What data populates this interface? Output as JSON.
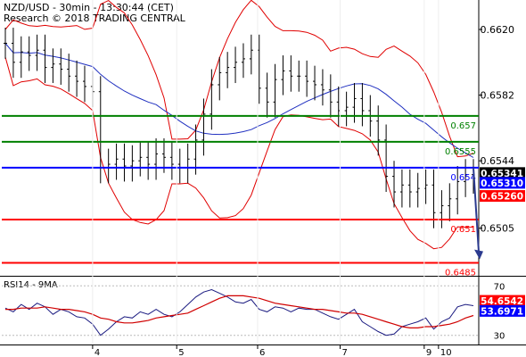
{
  "header": {
    "title": "NZD/USD - 30min - 13:30:44 (CET)",
    "copyright": "Research © 2018 TRADING CENTRAL"
  },
  "rsi_label": "RSI14 - 9MA",
  "chart_data": {
    "type": "candlestick",
    "instrument": "NZD/USD",
    "timeframe": "30min",
    "price_axis": {
      "ylim": [
        0.6478,
        0.6636
      ],
      "ticks": [
        {
          "label": "0.6620",
          "value": 0.662
        },
        {
          "label": "0.6582",
          "value": 0.6582
        },
        {
          "label": "0.6544",
          "value": 0.6544
        },
        {
          "label": "0.6505",
          "value": 0.6505
        }
      ]
    },
    "x_axis": {
      "ticks": [
        {
          "label": "4",
          "bar": 11
        },
        {
          "label": "5",
          "bar": 21.6
        },
        {
          "label": "6",
          "bar": 31.8
        },
        {
          "label": "7",
          "bar": 42.2
        },
        {
          "label": "9",
          "bar": 52.8
        },
        {
          "label": "10",
          "bar": 54.6
        }
      ],
      "n_bars": 60
    },
    "levels": [
      {
        "label": "0.657",
        "value": 0.657,
        "color": "#008000"
      },
      {
        "label": "0.6555",
        "value": 0.6555,
        "color": "#008000"
      },
      {
        "label": "0.654",
        "value": 0.654,
        "color": "#0000ff"
      },
      {
        "label": "0.651",
        "value": 0.651,
        "color": "#ff0000"
      },
      {
        "label": "0.6485",
        "value": 0.6485,
        "color": "#ff0000"
      }
    ],
    "price_badges": [
      {
        "label": "0.65341",
        "value": 0.65341,
        "bg": "#000000"
      },
      {
        "label": "0.65310",
        "value": 0.6531,
        "bg": "#0000ff"
      },
      {
        "label": "0.65260",
        "value": 0.6526,
        "bg": "#ff0000"
      }
    ],
    "forecast_arrow": {
      "from": 0.654,
      "to": 0.6487,
      "color": "#2b3a8f"
    },
    "close": [
      0.6612,
      0.6601,
      0.6607,
      0.6605,
      0.6608,
      0.6598,
      0.66,
      0.6597,
      0.6593,
      0.659,
      0.6587,
      0.6584,
      0.654,
      0.6542,
      0.6545,
      0.6541,
      0.6544,
      0.6546,
      0.6542,
      0.6548,
      0.6546,
      0.6542,
      0.654,
      0.6545,
      0.6556,
      0.6571,
      0.6588,
      0.6595,
      0.6598,
      0.6601,
      0.6603,
      0.6608,
      0.6586,
      0.6578,
      0.6591,
      0.6596,
      0.6593,
      0.6593,
      0.659,
      0.6588,
      0.6585,
      0.6578,
      0.6573,
      0.6575,
      0.658,
      0.6573,
      0.6567,
      0.6556,
      0.6535,
      0.6526,
      0.653,
      0.6526,
      0.6528,
      0.653,
      0.6514,
      0.6518,
      0.6522,
      0.6532,
      0.6536,
      0.6534
    ],
    "rsi": {
      "ylim": [
        24,
        76
      ],
      "ticks": [
        {
          "label": "70",
          "value": 70
        },
        {
          "label": "30",
          "value": 30
        }
      ],
      "badges": [
        {
          "label": "54.6542",
          "value": 54.65,
          "bg": "#ff0000"
        },
        {
          "label": "53.6971",
          "value": 53.7,
          "bg": "#0000ff"
        }
      ],
      "rsi_values": [
        52,
        49,
        55,
        51,
        56,
        53,
        47,
        51,
        49,
        45,
        44,
        39,
        30,
        35,
        41,
        45,
        44,
        49,
        47,
        51,
        47,
        45,
        49,
        55,
        61,
        65,
        67,
        64,
        61,
        57,
        56,
        59,
        51,
        49,
        53,
        52,
        49,
        52,
        51,
        51,
        48,
        45,
        43,
        47,
        51,
        41,
        37,
        33,
        30,
        31,
        37,
        39,
        41,
        44,
        35,
        41,
        44,
        53,
        55,
        54
      ],
      "ma_values": [
        51,
        51,
        52,
        52,
        52,
        53,
        52,
        51,
        51,
        50,
        49,
        47,
        44,
        43,
        41,
        40,
        40,
        41,
        42,
        44,
        45,
        46,
        47,
        48,
        51,
        54,
        57,
        60,
        62,
        62,
        62,
        61,
        60,
        58,
        56,
        55,
        54,
        53,
        52,
        51,
        51,
        50,
        49,
        48,
        48,
        47,
        45,
        43,
        41,
        39,
        37,
        36,
        36,
        37,
        37,
        38,
        39,
        41,
        44,
        46
      ]
    }
  }
}
